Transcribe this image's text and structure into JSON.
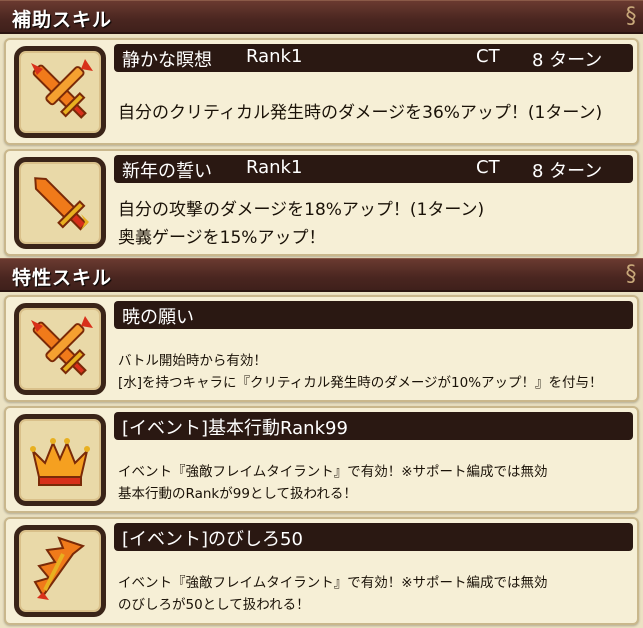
{
  "sections": {
    "support": {
      "title": "補助スキル"
    },
    "trait": {
      "title": "特性スキル"
    }
  },
  "support_skills": [
    {
      "icon": "crossed-swords-icon",
      "name": "静かな瞑想",
      "rank": "Rank1",
      "ct_label": "CT",
      "ct_turns": "8 ターン",
      "desc": [
        "自分のクリティカル発生時のダメージを36%アップ！(1ターン)"
      ]
    },
    {
      "icon": "sword-icon",
      "name": "新年の誓い",
      "rank": "Rank1",
      "ct_label": "CT",
      "ct_turns": "8 ターン",
      "desc": [
        "自分の攻撃のダメージを18%アップ！(1ターン)",
        "奥義ゲージを15%アップ！"
      ]
    }
  ],
  "trait_skills": [
    {
      "icon": "crossed-swords-icon",
      "name": "暁の願い",
      "desc": [
        "バトル開始時から有効！",
        "[水]を持つキャラに『クリティカル発生時のダメージが10%アップ！』を付与！"
      ]
    },
    {
      "icon": "crown-icon",
      "name": "[イベント]基本行動Rank99",
      "desc": [
        "イベント『強敵フレイムタイラント』で有効！※サポート編成では無効",
        "基本行動のRankが99として扱われる！"
      ]
    },
    {
      "icon": "drill-icon",
      "name": "[イベント]のびしろ50",
      "desc": [
        "イベント『強敵フレイムタイラント』で有効！※サポート編成では無効",
        "のびしろが50として扱われる！"
      ]
    }
  ],
  "colors": {
    "header_bg": "#4a2620",
    "name_bar_bg": "#2a1812",
    "card_bg": "#f6efd6",
    "icon_orange": "#f07a1a",
    "icon_red": "#d8301a"
  }
}
